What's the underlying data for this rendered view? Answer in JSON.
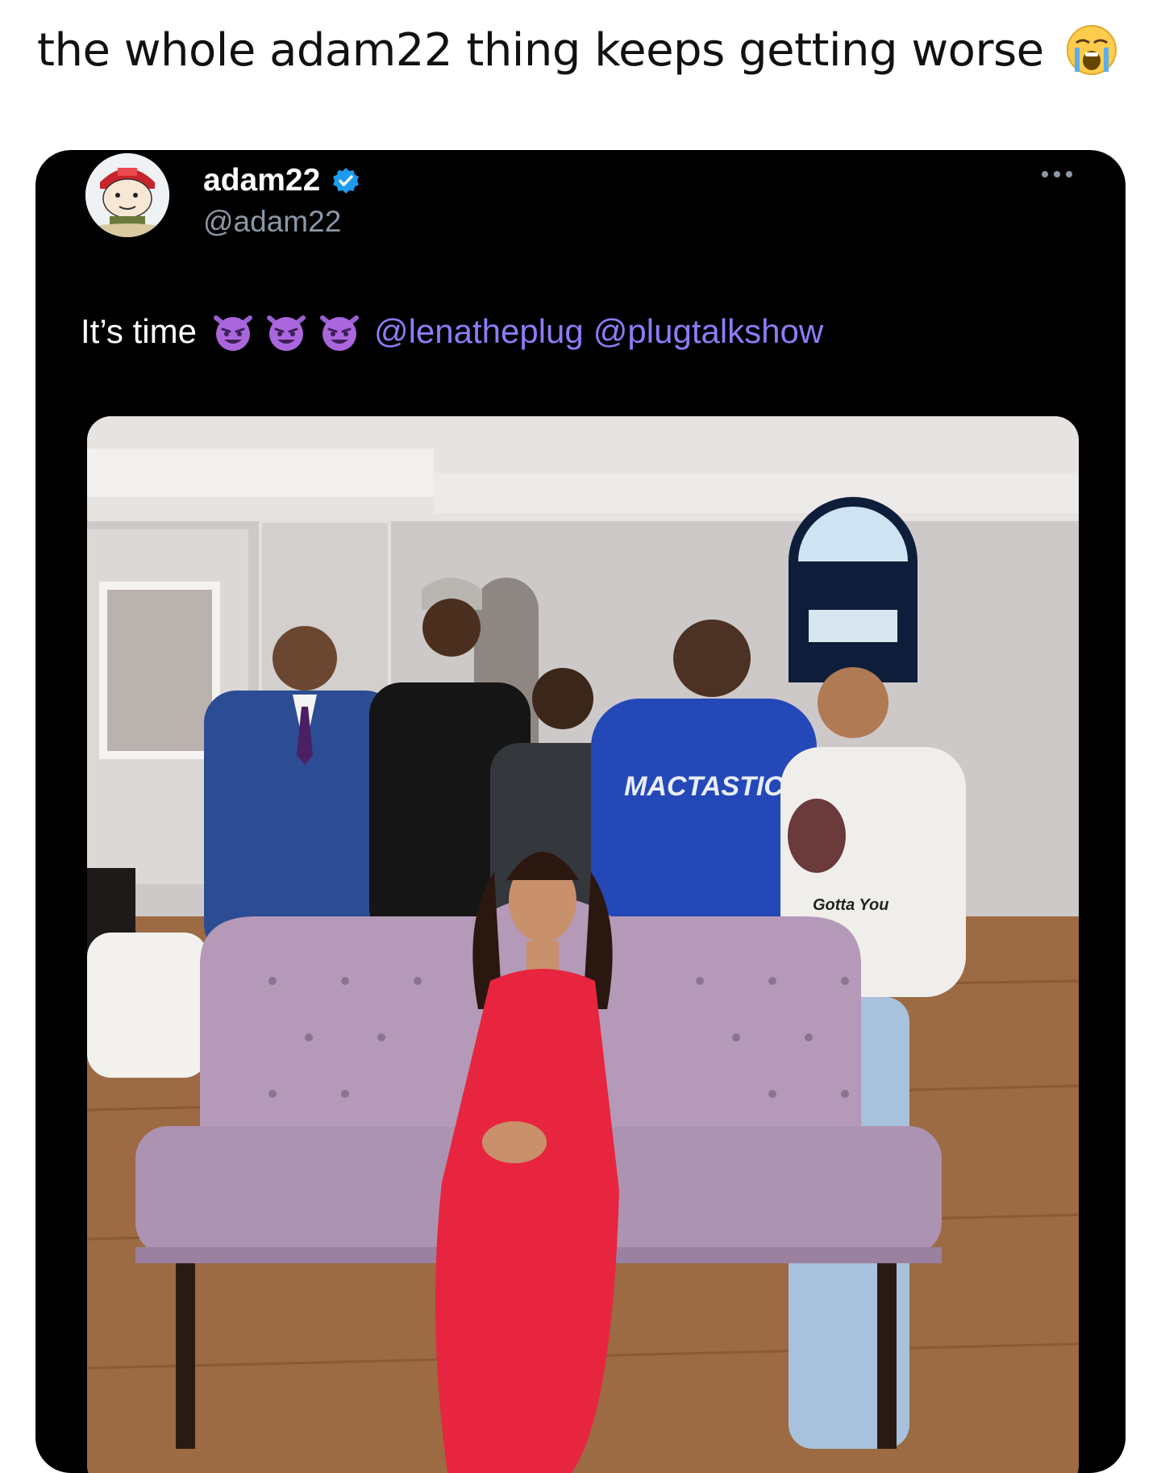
{
  "caption": {
    "text": "the whole adam22 thing keeps getting worse",
    "emoji": "loudly-crying-face-icon"
  },
  "tweet": {
    "display_name": "adam22",
    "handle": "@adam22",
    "verified": true,
    "text": "It’s time",
    "emojis": [
      "smiling-imp-icon",
      "smiling-imp-icon",
      "smiling-imp-icon"
    ],
    "mentions": [
      "@lenatheplug",
      "@plugtalkshow"
    ],
    "more_icon": "more-options-icon"
  },
  "photo": {
    "description": "",
    "sweatshirt_print": "MACTASTIC",
    "tshirt_print": "Gotta You"
  },
  "colors": {
    "tweet_bg": "#000000",
    "mention": "#8b7cf6",
    "handle": "#8b98a5",
    "verified": "#1d9bf0"
  }
}
